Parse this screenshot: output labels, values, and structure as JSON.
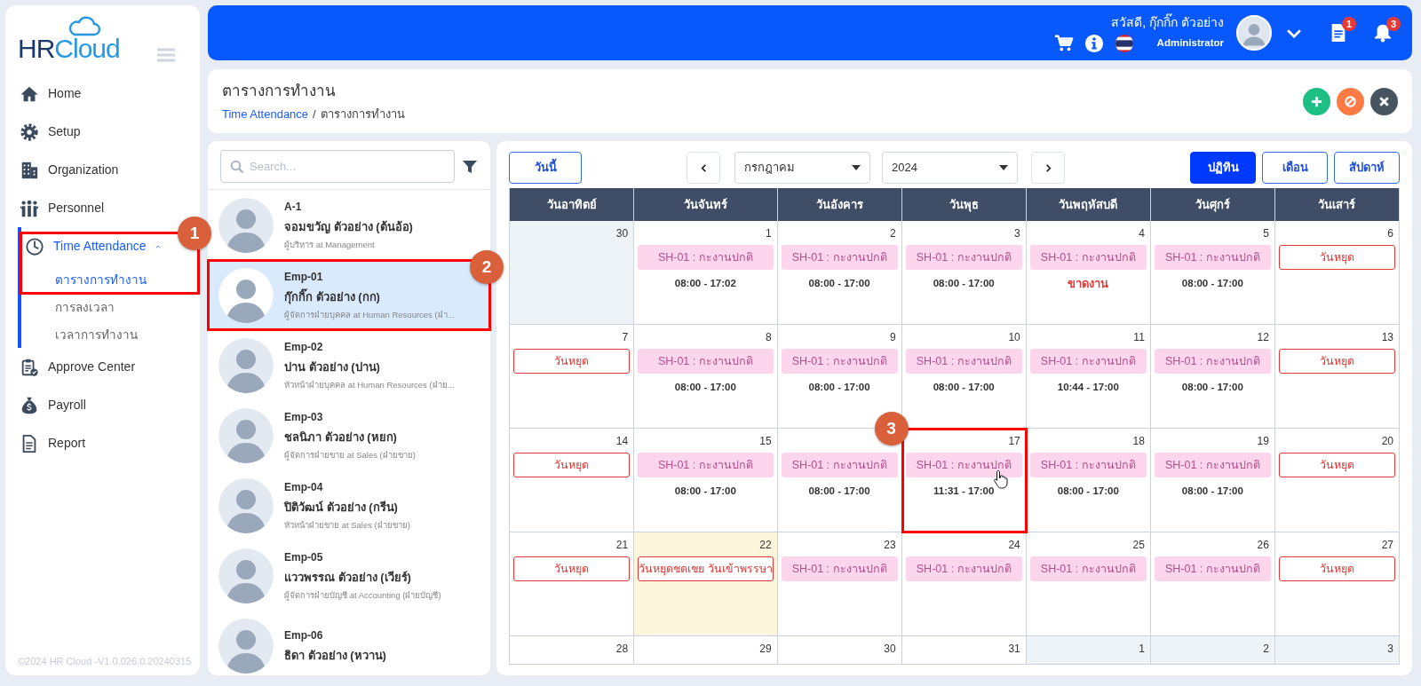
{
  "sidebar": {
    "logo": [
      "HR",
      "Cloud"
    ],
    "nav": [
      {
        "label": "Home",
        "selected": false
      },
      {
        "label": "Setup",
        "selected": false
      },
      {
        "label": "Organization",
        "selected": false
      },
      {
        "label": "Personnel",
        "selected": false
      },
      {
        "label": "Time Attendance",
        "selected": true,
        "expanded": true,
        "annotation": {
          "label": "1"
        },
        "children": [
          {
            "label": "ตารางการทำงาน",
            "selected": true
          },
          {
            "label": "การลงเวลา",
            "selected": false
          },
          {
            "label": "เวลาการทำงาน",
            "selected": false
          }
        ]
      },
      {
        "label": "Approve Center",
        "selected": false
      },
      {
        "label": "Payroll",
        "selected": false
      },
      {
        "label": "Report",
        "selected": false
      }
    ],
    "footer": "©2024 HR Cloud -V1.0.026.0.20240315"
  },
  "header": {
    "greeting": "สวัสดี, กุ๊กกิ๊ก ตัวอย่าง",
    "role": "Administrator",
    "document_count": "1",
    "notification_count": "3"
  },
  "page": {
    "title": "ตารางการทำงาน",
    "breadcrumb_separator": "/",
    "breadcrumb": [
      {
        "text": "Time Attendance",
        "current": false
      },
      {
        "text": "ตารางการทำงาน",
        "current": true
      }
    ],
    "actions": [
      {
        "kind": "add"
      },
      {
        "kind": "cancel"
      },
      {
        "kind": "close"
      }
    ]
  },
  "employees": {
    "search": {
      "placeholder": "Search..."
    },
    "items": [
      {
        "code": "A-1",
        "name": "จอมขวัญ ตัวอย่าง (ต้นอ้อ)",
        "position": "ผู้บริหาร at Management",
        "selected": false
      },
      {
        "code": "Emp-01",
        "name": "กุ๊กกิ๊ก ตัวอย่าง (กก)",
        "position": "ผู้จัดการฝ่ายบุคคล at Human Resources (ฝ่า...",
        "selected": true,
        "annotation": {
          "label": "2"
        }
      },
      {
        "code": "Emp-02",
        "name": "ปาน ตัวอย่าง (ปาน)",
        "position": "หัวหน้าฝ่ายบุคคล at Human Resources (ฝ่าย...",
        "selected": false
      },
      {
        "code": "Emp-03",
        "name": "ชลนิภา ตัวอย่าง (หยก)",
        "position": "ผู้จัดการฝ่ายขาย at Sales (ฝ่ายขาย)",
        "selected": false
      },
      {
        "code": "Emp-04",
        "name": "ปิติวัฒน์ ตัวอย่าง (กรีน)",
        "position": "หัวหน้าฝ่ายขาย at Sales (ฝ่ายขาย)",
        "selected": false
      },
      {
        "code": "Emp-05",
        "name": "แววพรรณ ตัวอย่าง (เวียร์)",
        "position": "ผู้จัดการฝ่ายบัญชี at Accounting (ฝ่ายบัญชี)",
        "selected": false
      },
      {
        "code": "Emp-06",
        "name": "ธิดา ตัวอย่าง (หวาน)",
        "selected": false
      }
    ]
  },
  "calendar": {
    "today_button": "วันนี้",
    "month": "กรกฎาคม",
    "year": "2024",
    "views": [
      {
        "label": "ปฏิทิน",
        "selected": true
      },
      {
        "label": "เดือน",
        "selected": false
      },
      {
        "label": "สัปดาห์",
        "selected": false
      }
    ],
    "weekdays": [
      "วันอาทิตย์",
      "วันจันทร์",
      "วันอังคาร",
      "วันพุธ",
      "วันพฤหัสบดี",
      "วันศุกร์",
      "วันเสาร์"
    ],
    "weeks": [
      [
        {
          "date": "30",
          "other_month": true,
          "today": false
        },
        {
          "date": "1",
          "other_month": false,
          "today": false,
          "events": [
            {
              "kind": "shift",
              "text": "SH-01 : กะงานปกติ"
            },
            {
              "kind": "time",
              "text": "08:00 - 17:02"
            }
          ]
        },
        {
          "date": "2",
          "other_month": false,
          "today": false,
          "events": [
            {
              "kind": "shift",
              "text": "SH-01 : กะงานปกติ"
            },
            {
              "kind": "time",
              "text": "08:00 - 17:00"
            }
          ]
        },
        {
          "date": "3",
          "other_month": false,
          "today": false,
          "events": [
            {
              "kind": "shift",
              "text": "SH-01 : กะงานปกติ"
            },
            {
              "kind": "time",
              "text": "08:00 - 17:00"
            }
          ]
        },
        {
          "date": "4",
          "other_month": false,
          "today": false,
          "events": [
            {
              "kind": "shift",
              "text": "SH-01 : กะงานปกติ"
            },
            {
              "kind": "absent",
              "text": "ขาดงาน"
            }
          ]
        },
        {
          "date": "5",
          "other_month": false,
          "today": false,
          "events": [
            {
              "kind": "shift",
              "text": "SH-01 : กะงานปกติ"
            },
            {
              "kind": "time",
              "text": "08:00 - 17:00"
            }
          ]
        },
        {
          "date": "6",
          "other_month": false,
          "today": false,
          "events": [
            {
              "kind": "holiday",
              "text": "วันหยุด"
            }
          ]
        }
      ],
      [
        {
          "date": "7",
          "other_month": false,
          "today": false,
          "events": [
            {
              "kind": "holiday",
              "text": "วันหยุด"
            }
          ]
        },
        {
          "date": "8",
          "other_month": false,
          "today": false,
          "events": [
            {
              "kind": "shift",
              "text": "SH-01 : กะงานปกติ"
            },
            {
              "kind": "time",
              "text": "08:00 - 17:00"
            }
          ]
        },
        {
          "date": "9",
          "other_month": false,
          "today": false,
          "events": [
            {
              "kind": "shift",
              "text": "SH-01 : กะงานปกติ"
            },
            {
              "kind": "time",
              "text": "08:00 - 17:00"
            }
          ]
        },
        {
          "date": "10",
          "other_month": false,
          "today": false,
          "events": [
            {
              "kind": "shift",
              "text": "SH-01 : กะงานปกติ"
            },
            {
              "kind": "time",
              "text": "08:00 - 17:00"
            }
          ]
        },
        {
          "date": "11",
          "other_month": false,
          "today": false,
          "events": [
            {
              "kind": "shift",
              "text": "SH-01 : กะงานปกติ"
            },
            {
              "kind": "time",
              "text": "10:44 - 17:00"
            }
          ]
        },
        {
          "date": "12",
          "other_month": false,
          "today": false,
          "events": [
            {
              "kind": "shift",
              "text": "SH-01 : กะงานปกติ"
            },
            {
              "kind": "time",
              "text": "08:00 - 17:00"
            }
          ]
        },
        {
          "date": "13",
          "other_month": false,
          "today": false,
          "events": [
            {
              "kind": "holiday",
              "text": "วันหยุด"
            }
          ]
        }
      ],
      [
        {
          "date": "14",
          "other_month": false,
          "today": false,
          "events": [
            {
              "kind": "holiday",
              "text": "วันหยุด"
            }
          ]
        },
        {
          "date": "15",
          "other_month": false,
          "today": false,
          "events": [
            {
              "kind": "shift",
              "text": "SH-01 : กะงานปกติ"
            },
            {
              "kind": "time",
              "text": "08:00 - 17:00"
            }
          ]
        },
        {
          "other_month": false,
          "today": false,
          "events": [
            {
              "kind": "shift",
              "text": "SH-01 : กะงานปกติ"
            },
            {
              "kind": "time",
              "text": "08:00 - 17:00"
            }
          ]
        },
        {
          "date": "17",
          "other_month": false,
          "today": false,
          "pointer": true,
          "annotation": {
            "label": "3"
          },
          "events": [
            {
              "kind": "shift",
              "text": "SH-01 : กะงานปกติ"
            },
            {
              "kind": "time",
              "text": "11:31 - 17:00"
            }
          ]
        },
        {
          "date": "18",
          "other_month": false,
          "today": false,
          "events": [
            {
              "kind": "shift",
              "text": "SH-01 : กะงานปกติ"
            },
            {
              "kind": "time",
              "text": "08:00 - 17:00"
            }
          ]
        },
        {
          "date": "19",
          "other_month": false,
          "today": false,
          "events": [
            {
              "kind": "shift",
              "text": "SH-01 : กะงานปกติ"
            },
            {
              "kind": "time",
              "text": "08:00 - 17:00"
            }
          ]
        },
        {
          "date": "20",
          "other_month": false,
          "today": false,
          "events": [
            {
              "kind": "holiday",
              "text": "วันหยุด"
            }
          ]
        }
      ],
      [
        {
          "date": "21",
          "other_month": false,
          "today": false,
          "events": [
            {
              "kind": "holiday",
              "text": "วันหยุด"
            }
          ]
        },
        {
          "date": "22",
          "other_month": false,
          "today": true,
          "events": [
            {
              "kind": "holiday",
              "text": "วันหยุดชดเชย วันเข้าพรรษา"
            }
          ]
        },
        {
          "date": "23",
          "other_month": false,
          "today": false,
          "events": [
            {
              "kind": "shift",
              "text": "SH-01 : กะงานปกติ"
            }
          ]
        },
        {
          "date": "24",
          "other_month": false,
          "today": false,
          "events": [
            {
              "kind": "shift",
              "text": "SH-01 : กะงานปกติ"
            }
          ]
        },
        {
          "date": "25",
          "other_month": false,
          "today": false,
          "events": [
            {
              "kind": "shift",
              "text": "SH-01 : กะงานปกติ"
            }
          ]
        },
        {
          "date": "26",
          "other_month": false,
          "today": false,
          "events": [
            {
              "kind": "shift",
              "text": "SH-01 : กะงานปกติ"
            }
          ]
        },
        {
          "date": "27",
          "other_month": false,
          "today": false,
          "events": [
            {
              "kind": "holiday",
              "text": "วันหยุด"
            }
          ]
        }
      ],
      [
        {
          "date": "28",
          "other_month": false,
          "today": false
        },
        {
          "date": "29",
          "other_month": false,
          "today": false
        },
        {
          "date": "30",
          "other_month": false,
          "today": false
        },
        {
          "date": "31",
          "other_month": false,
          "today": false
        },
        {
          "date": "1",
          "other_month": true,
          "today": false
        },
        {
          "date": "2",
          "other_month": true,
          "today": false
        },
        {
          "date": "3",
          "other_month": true,
          "today": false
        }
      ]
    ]
  }
}
